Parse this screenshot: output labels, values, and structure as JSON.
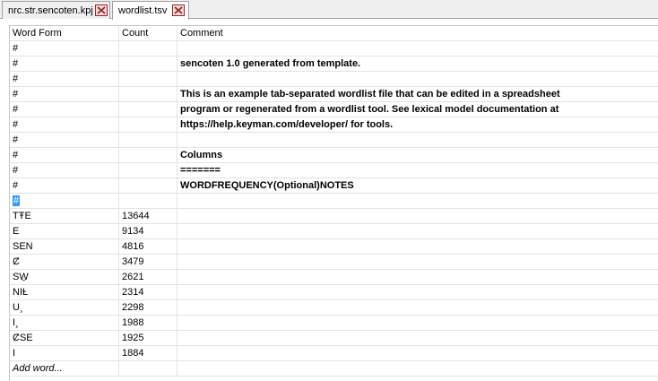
{
  "tabs": [
    {
      "label": "nrc.str.sencoten.kpj"
    },
    {
      "label": "wordlist.tsv"
    }
  ],
  "table": {
    "columns": [
      "Word Form",
      "Count",
      "Comment"
    ],
    "rows": [
      {
        "word": "#",
        "count": "",
        "comment": ""
      },
      {
        "word": "#",
        "count": "",
        "comment": "sencoten 1.0 generated from template."
      },
      {
        "word": "#",
        "count": "",
        "comment": ""
      },
      {
        "word": "#",
        "count": "",
        "comment": "This is an example tab-separated wordlist file that can be edited in a spreadsheet"
      },
      {
        "word": "#",
        "count": "",
        "comment": "program or regenerated from a wordlist tool. See lexical model documentation at"
      },
      {
        "word": "#",
        "count": "",
        "comment": "https://help.keyman.com/developer/ for tools."
      },
      {
        "word": "#",
        "count": "",
        "comment": ""
      },
      {
        "word": "#",
        "count": "",
        "comment": "Columns"
      },
      {
        "word": "#",
        "count": "",
        "comment": "======="
      },
      {
        "word": "#",
        "count": "",
        "comment": "WORDFREQUENCY(Optional)NOTES"
      },
      {
        "word": "#",
        "count": "",
        "comment": ""
      },
      {
        "word": "TŦE",
        "count": "13644",
        "comment": ""
      },
      {
        "word": "E",
        "count": "9134",
        "comment": ""
      },
      {
        "word": "SEN",
        "count": "4816",
        "comment": ""
      },
      {
        "word": "Ȼ",
        "count": "3479",
        "comment": ""
      },
      {
        "word": "SW̱",
        "count": "2621",
        "comment": ""
      },
      {
        "word": "NIȽ",
        "count": "2314",
        "comment": ""
      },
      {
        "word": "U¸",
        "count": "2298",
        "comment": ""
      },
      {
        "word": "I¸",
        "count": "1988",
        "comment": ""
      },
      {
        "word": "ȻSE",
        "count": "1925",
        "comment": ""
      },
      {
        "word": "I",
        "count": "1884",
        "comment": ""
      }
    ],
    "add_word_label": "Add word..."
  }
}
